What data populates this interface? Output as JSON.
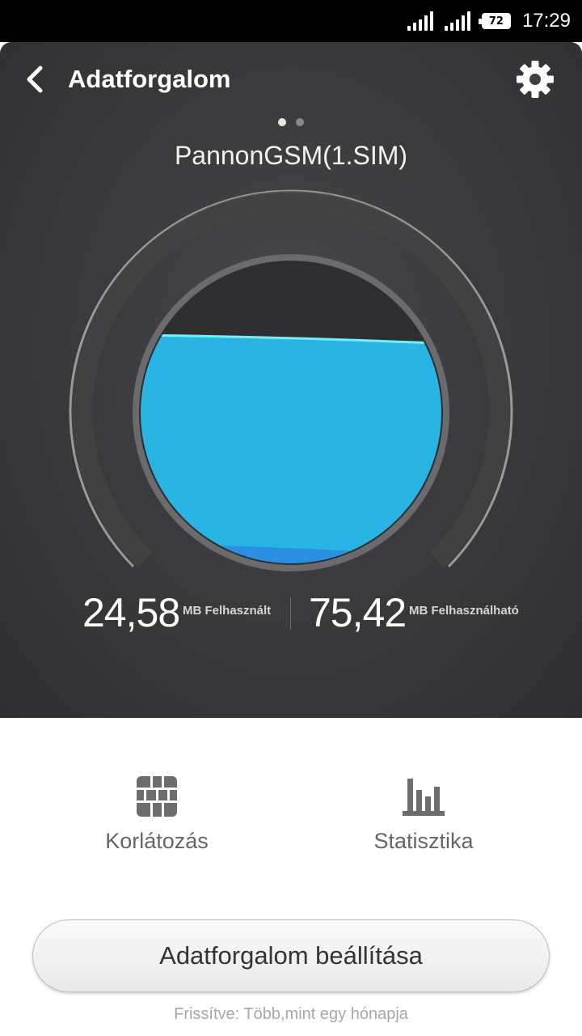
{
  "status_bar": {
    "time": "17:29",
    "battery": "72"
  },
  "header": {
    "title": "Adatforgalom",
    "back_icon": "chevron-left-icon",
    "settings_icon": "gear-icon"
  },
  "page_indicator": {
    "pages": 2,
    "active": 0
  },
  "sim": {
    "name": "PannonGSM(1.SIM)"
  },
  "usage": {
    "used_value": "24,58",
    "used_label": "MB Felhasznált",
    "available_value": "75,42",
    "available_label": "MB Felhasználható",
    "fill_fraction": 0.75
  },
  "actions": [
    {
      "label": "Korlátozás",
      "icon": "firewall-icon"
    },
    {
      "label": "Statisztika",
      "icon": "bar-chart-icon"
    }
  ],
  "settings_button": {
    "label": "Adatforgalom beállítása"
  },
  "footer": {
    "updated_text": "Frissítve: Több,mint egy hónapja"
  },
  "colors": {
    "water": "#29b4e4",
    "water_line": "#6ff0ff",
    "panel_bg": "#3b3b3d"
  }
}
